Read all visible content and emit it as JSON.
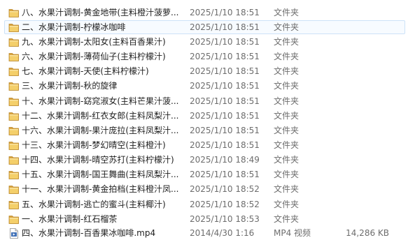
{
  "files": [
    {
      "name": "八、水果汁调制-黄金地带(主料橙汁菠萝...",
      "date": "2025/1/10 18:51",
      "type": "文件夹",
      "size": "",
      "icon": "folder-icon"
    },
    {
      "name": "二、水果汁调制-柠檬冰咖啡",
      "date": "2025/1/10 18:51",
      "type": "文件夹",
      "size": "",
      "icon": "folder-icon",
      "selected": true
    },
    {
      "name": "九、水果汁调制-太阳女(主料百香果汁)",
      "date": "2025/1/10 18:51",
      "type": "文件夹",
      "size": "",
      "icon": "folder-icon"
    },
    {
      "name": "六、水果汁调制-薄荷仙子(主料柠檬汁)",
      "date": "2025/1/10 18:51",
      "type": "文件夹",
      "size": "",
      "icon": "folder-icon"
    },
    {
      "name": "七、水果汁调制-天使(主料柠檬汁)",
      "date": "2025/1/10 18:51",
      "type": "文件夹",
      "size": "",
      "icon": "folder-icon"
    },
    {
      "name": "三、水果汁调制-秋的旋律",
      "date": "2025/1/10 18:51",
      "type": "文件夹",
      "size": "",
      "icon": "folder-icon"
    },
    {
      "name": "十、水果汁调制-窈窕淑女(主料芒果汁菠...",
      "date": "2025/1/10 18:51",
      "type": "文件夹",
      "size": "",
      "icon": "folder-icon"
    },
    {
      "name": "十二、水果汁调制-红衣女郎(主料凤梨汁...",
      "date": "2025/1/10 18:51",
      "type": "文件夹",
      "size": "",
      "icon": "folder-icon"
    },
    {
      "name": "十六、水果汁调制-果汁庞拉(主料凤梨汁...",
      "date": "2025/1/10 18:51",
      "type": "文件夹",
      "size": "",
      "icon": "folder-icon"
    },
    {
      "name": "十三、水果汁调制-梦幻晴空(主料橙汁)",
      "date": "2025/1/10 18:51",
      "type": "文件夹",
      "size": "",
      "icon": "folder-icon"
    },
    {
      "name": "十四、水果汁调制-晴空苏打(主料柠檬汁)",
      "date": "2025/1/10 18:49",
      "type": "文件夹",
      "size": "",
      "icon": "folder-icon"
    },
    {
      "name": "十五、水果汁调制-国王舞曲(主料凤梨汁...",
      "date": "2025/1/10 18:51",
      "type": "文件夹",
      "size": "",
      "icon": "folder-icon"
    },
    {
      "name": "十一、水果汁调制-黄金拍档(主料橙汁凤...",
      "date": "2025/1/10 18:52",
      "type": "文件夹",
      "size": "",
      "icon": "folder-icon"
    },
    {
      "name": "五、水果汁调制-逃亡的蜜斗(主料椰汁)",
      "date": "2025/1/10 18:52",
      "type": "文件夹",
      "size": "",
      "icon": "folder-icon"
    },
    {
      "name": "一、水果汁调制-红石榴茶",
      "date": "2025/1/10 18:53",
      "type": "文件夹",
      "size": "",
      "icon": "folder-icon"
    },
    {
      "name": "四、水果汁调制-百香果冰咖啡.mp4",
      "date": "2014/4/30 1:16",
      "type": "MP4 视频",
      "size": "14,286 KB",
      "icon": "video-file-icon"
    }
  ]
}
